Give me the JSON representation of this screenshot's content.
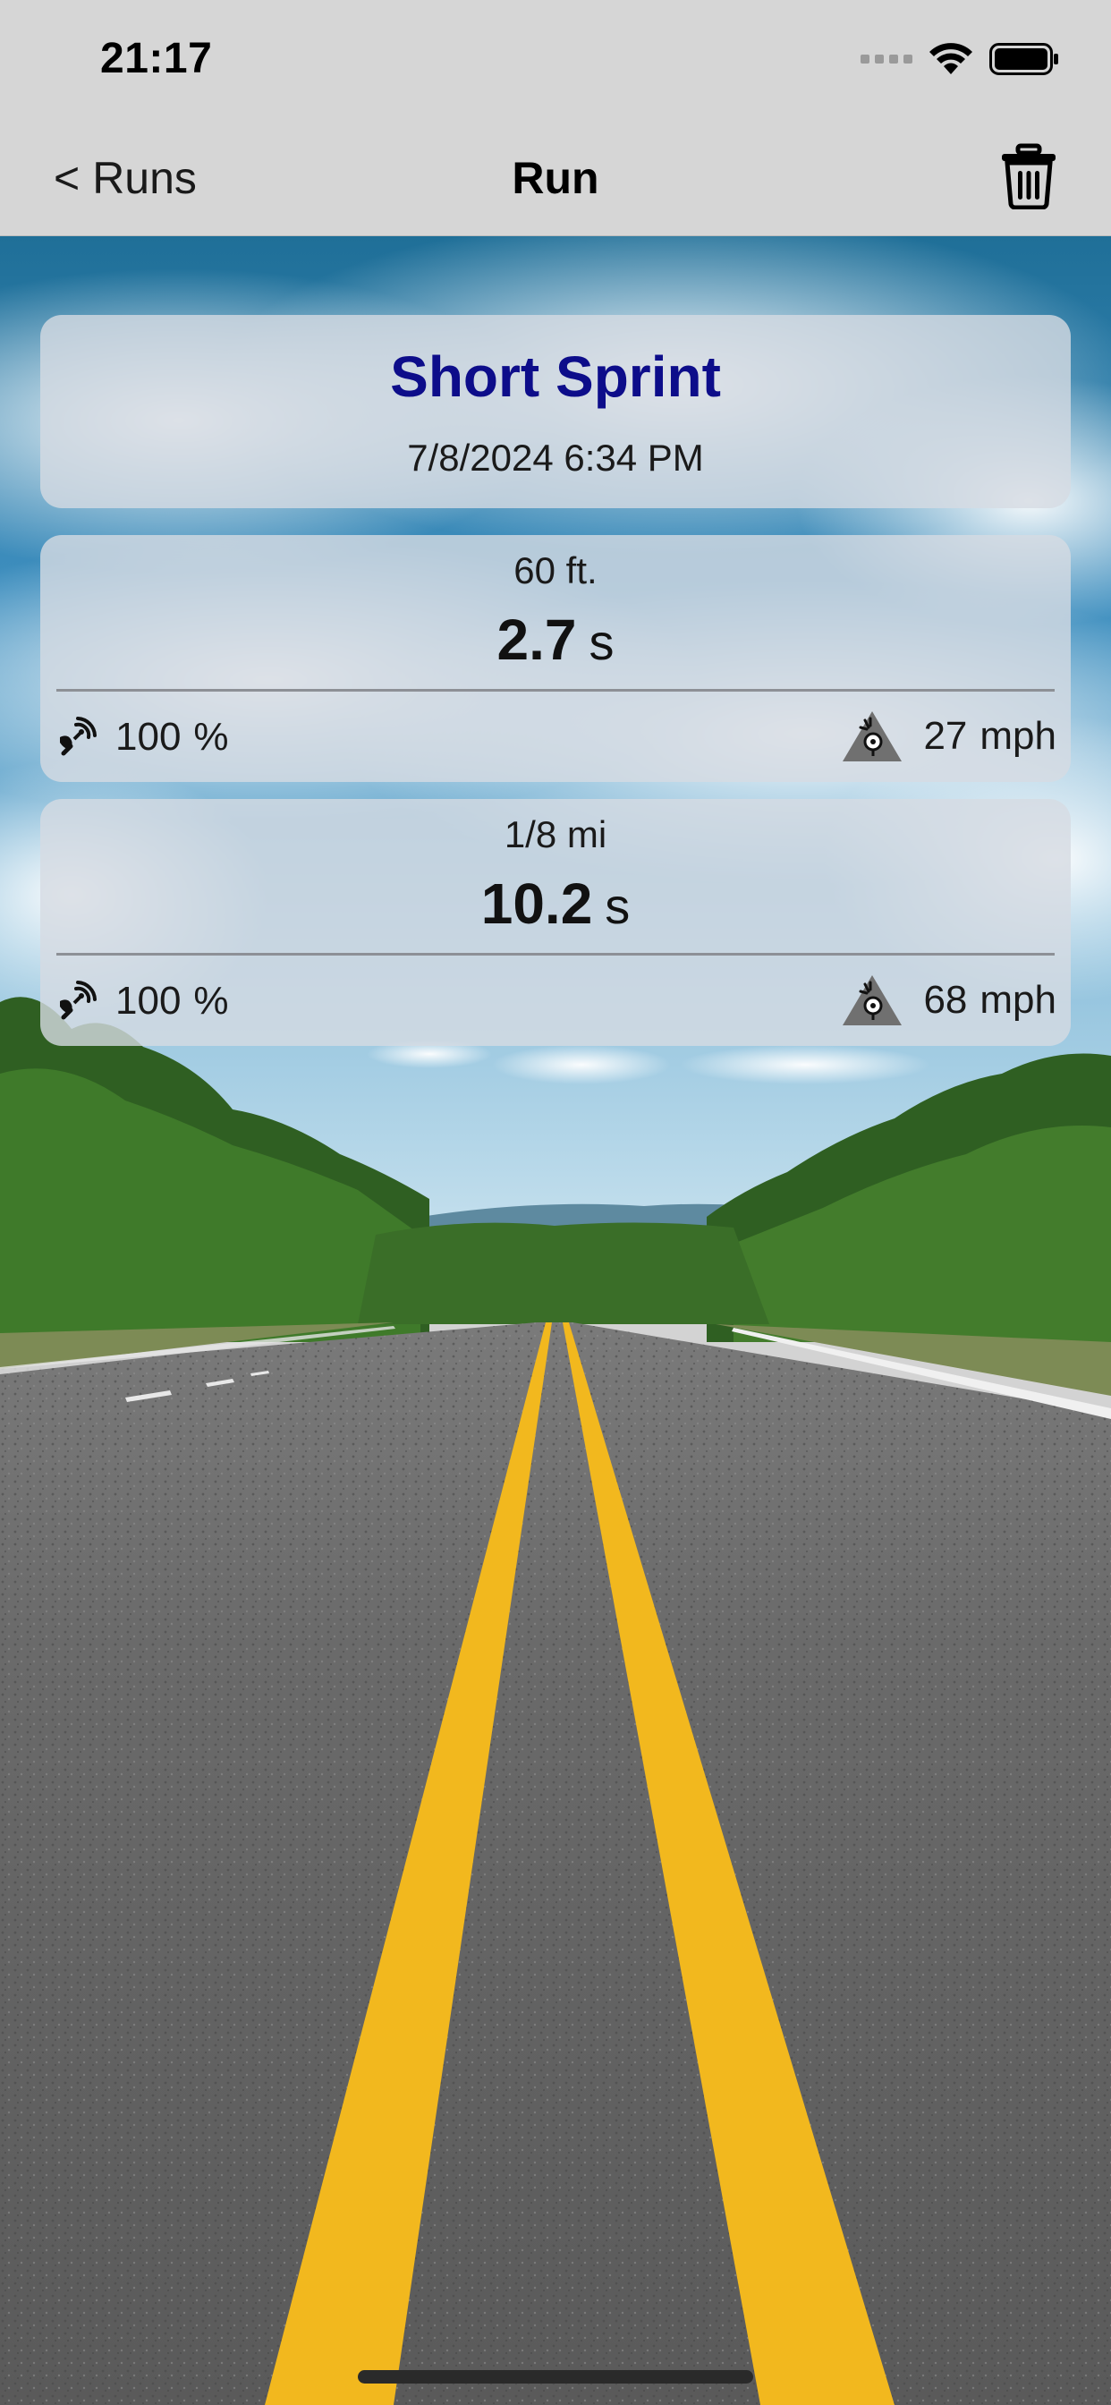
{
  "status_bar": {
    "time": "21:17"
  },
  "nav": {
    "back_label": "Runs",
    "title": "Run"
  },
  "run": {
    "name": "Short Sprint",
    "datetime": "7/8/2024 6:34 PM"
  },
  "splits": [
    {
      "distance": "60 ft.",
      "time": "2.7",
      "time_unit": "s",
      "signal_value": "100",
      "signal_unit": "%",
      "speed_value": "27",
      "speed_unit": "mph"
    },
    {
      "distance": "1/8 mi",
      "time": "10.2",
      "time_unit": "s",
      "signal_value": "100",
      "signal_unit": "%",
      "speed_value": "68",
      "speed_unit": "mph"
    }
  ],
  "colors": {
    "title_blue": "#0d0d8a",
    "road_line_yellow": "#f2b81e",
    "card_bg": "#d6dbe2"
  },
  "icons": {
    "back": "chevron-left-icon",
    "trash": "trash-icon",
    "signal": "gps-signal-icon",
    "speed": "speed-camera-icon"
  }
}
